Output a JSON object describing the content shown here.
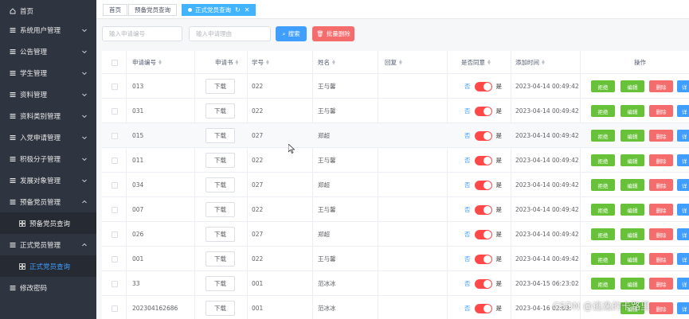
{
  "sidebar": {
    "items": [
      {
        "label": "首页",
        "icon": "home-icon",
        "arrow": false
      },
      {
        "label": "系统用户管理",
        "icon": "menu-icon",
        "arrow": "down"
      },
      {
        "label": "公告管理",
        "icon": "menu-icon",
        "arrow": "down"
      },
      {
        "label": "学生管理",
        "icon": "menu-icon",
        "arrow": "down"
      },
      {
        "label": "资料管理",
        "icon": "menu-icon",
        "arrow": "down"
      },
      {
        "label": "资料类别管理",
        "icon": "menu-icon",
        "arrow": "down"
      },
      {
        "label": "入党申请管理",
        "icon": "menu-icon",
        "arrow": "down"
      },
      {
        "label": "积极分子管理",
        "icon": "menu-icon",
        "arrow": "down"
      },
      {
        "label": "发展对象管理",
        "icon": "menu-icon",
        "arrow": "down"
      },
      {
        "label": "预备党员管理",
        "icon": "menu-icon",
        "arrow": "up"
      },
      {
        "label": "预备党员查询",
        "icon": "grid-icon",
        "arrow": false,
        "sub": true
      },
      {
        "label": "正式党员管理",
        "icon": "menu-icon",
        "arrow": "up"
      },
      {
        "label": "正式党员查询",
        "icon": "grid-icon",
        "arrow": false,
        "sub": true,
        "active": true
      },
      {
        "label": "修改密码",
        "icon": "menu-icon",
        "arrow": false
      }
    ]
  },
  "tabs": [
    {
      "label": "首页",
      "active": false
    },
    {
      "label": "预备党员查询",
      "active": false
    },
    {
      "label": "正式党员查询",
      "active": true
    }
  ],
  "search": {
    "placeholder_no": "输入申请编号",
    "placeholder_name": "输入申请理由",
    "search_label": "搜索",
    "batch_delete_label": "批量删除"
  },
  "table": {
    "headers": {
      "no": "申请编号",
      "letter": "申请书",
      "sid": "学号",
      "name": "姓名",
      "reply": "回复",
      "agree": "是否同意",
      "time": "添加时间",
      "ops": "操作"
    },
    "labels": {
      "download": "下载",
      "switch_no": "否",
      "switch_yes": "是",
      "reject": "拒绝",
      "edit": "编辑",
      "delete": "删除",
      "detail": "详"
    },
    "rows": [
      {
        "no": "013",
        "sid": "022",
        "name": "王与馨",
        "reply": "",
        "agree": false,
        "time": "2023-04-14 00:49:42",
        "reject": true
      },
      {
        "no": "031",
        "sid": "022",
        "name": "王与馨",
        "reply": "",
        "agree": false,
        "time": "2023-04-14 00:49:42",
        "reject": true
      },
      {
        "no": "015",
        "sid": "027",
        "name": "郑超",
        "reply": "",
        "agree": false,
        "time": "2023-04-14 00:49:42",
        "reject": true
      },
      {
        "no": "011",
        "sid": "022",
        "name": "王与馨",
        "reply": "",
        "agree": false,
        "time": "2023-04-14 00:49:42",
        "reject": true
      },
      {
        "no": "034",
        "sid": "027",
        "name": "郑超",
        "reply": "",
        "agree": false,
        "time": "2023-04-14 00:49:42",
        "reject": true
      },
      {
        "no": "007",
        "sid": "022",
        "name": "王与馨",
        "reply": "",
        "agree": false,
        "time": "2023-04-14 00:49:42",
        "reject": true
      },
      {
        "no": "026",
        "sid": "027",
        "name": "郑超",
        "reply": "",
        "agree": false,
        "time": "2023-04-14 00:49:42",
        "reject": true
      },
      {
        "no": "001",
        "sid": "022",
        "name": "王与馨",
        "reply": "",
        "agree": false,
        "time": "2023-04-14 00:49:42",
        "reject": true
      },
      {
        "no": "33",
        "sid": "001",
        "name": "范冰冰",
        "reply": "",
        "agree": false,
        "time": "2023-04-15 06:23:02",
        "reject": true
      },
      {
        "no": "202304162686",
        "sid": "001",
        "name": "范冰冰",
        "reply": "",
        "agree": false,
        "time": "2023-04-16 02:03:",
        "reject": false
      }
    ]
  },
  "watermark": "CSDN @逃逸的卡路里",
  "colors": {
    "sidebar_bg": "#2f3540",
    "primary": "#409eff",
    "success": "#67c23a",
    "danger": "#f56c6c",
    "switch_off": "#ff4949"
  }
}
